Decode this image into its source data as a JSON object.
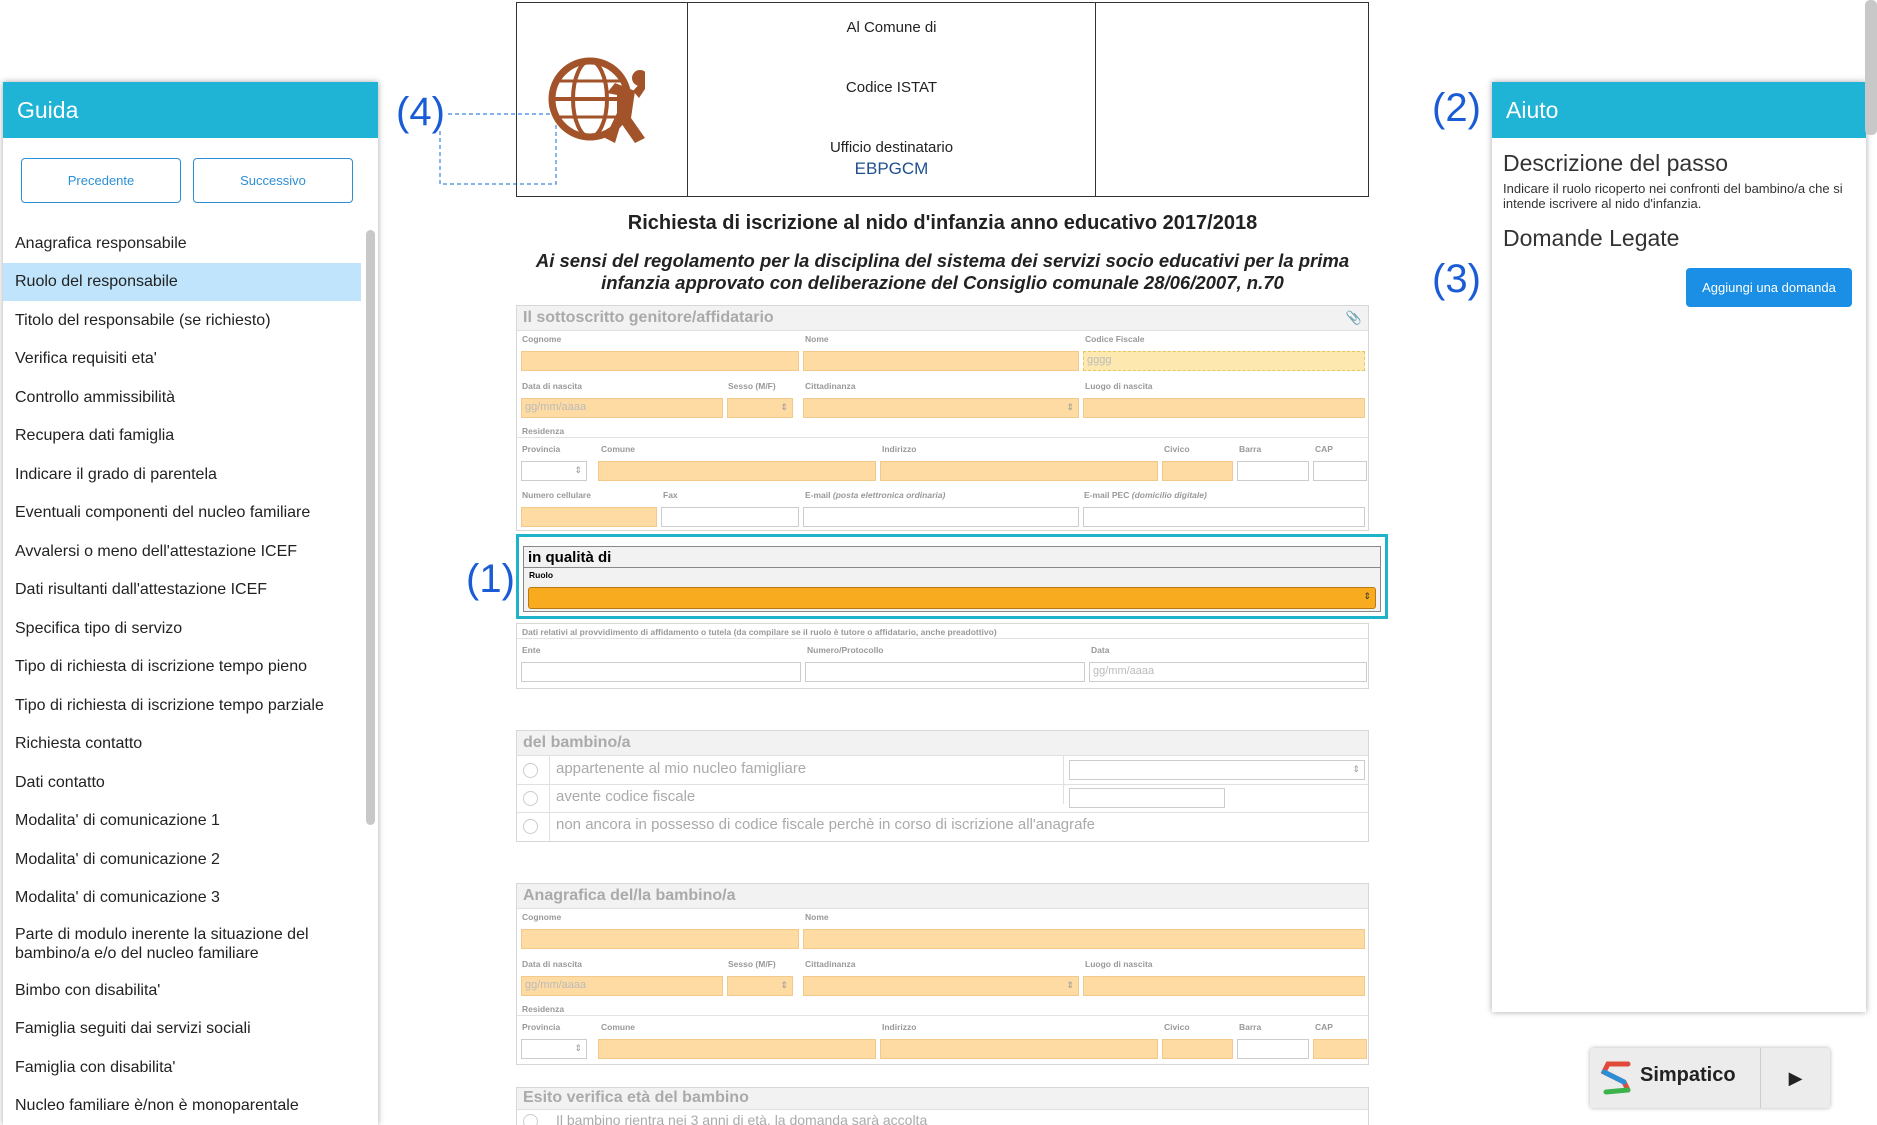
{
  "guida": {
    "title": "Guida",
    "prev_label": "Precedente",
    "next_label": "Successivo",
    "items": [
      {
        "label": "Anagrafica responsabile"
      },
      {
        "label": "Ruolo del responsabile"
      },
      {
        "label": "Titolo del responsabile (se richiesto)"
      },
      {
        "label": "Verifica requisiti eta'"
      },
      {
        "label": "Controllo ammissibilità"
      },
      {
        "label": "Recupera dati famiglia"
      },
      {
        "label": "Indicare il grado di parentela"
      },
      {
        "label": "Eventuali componenti del nucleo familiare"
      },
      {
        "label": "Avvalersi o meno dell'attestazione ICEF"
      },
      {
        "label": "Dati risultanti dall'attestazione ICEF"
      },
      {
        "label": "Specifica tipo di servizo"
      },
      {
        "label": "Tipo di richiesta di iscrizione tempo pieno"
      },
      {
        "label": "Tipo di richiesta di iscrizione tempo parziale"
      },
      {
        "label": "Richiesta contatto"
      },
      {
        "label": "Dati contatto"
      },
      {
        "label": "Modalita' di comunicazione 1"
      },
      {
        "label": "Modalita' di comunicazione 2"
      },
      {
        "label": "Modalita' di comunicazione 3"
      },
      {
        "label": "Parte di modulo inerente la situazione del bambino/a e/o del nucleo familiare"
      },
      {
        "label": "Bimbo con disabilita'"
      },
      {
        "label": "Famiglia seguiti dai servizi sociali"
      },
      {
        "label": "Famiglia con disabilita'"
      },
      {
        "label": "Nucleo familiare è/non è monoparentale"
      }
    ],
    "active_index": 1
  },
  "aiuto": {
    "title": "Aiuto",
    "desc_title": "Descrizione del passo",
    "desc_text": "Indicare il ruolo ricoperto nei confronti del bambino/a che si intende iscrivere al nido d'infanzia.",
    "linked_title": "Domande Legate",
    "add_label": "Aggiungi una domanda"
  },
  "markers": {
    "m1": "(1)",
    "m2": "(2)",
    "m3": "(3)",
    "m4": "(4)"
  },
  "header": {
    "comune": "Al Comune di",
    "istat": "Codice ISTAT",
    "ufficio": "Ufficio destinatario",
    "ufficio_code": "EBPGCM"
  },
  "form": {
    "title": "Richiesta di iscrizione al nido d'infanzia anno educativo 2017/2018",
    "subtitle": "Ai sensi del regolamento per la disciplina del sistema dei servizi socio educativi per la prima infanzia approvato con deliberazione del Consiglio comunale 28/06/2007, n.70",
    "sottoscritto": {
      "title": "Il sottoscritto genitore/affidatario",
      "cognome": "Cognome",
      "nome": "Nome",
      "cf": "Codice Fiscale",
      "cf_value": "gggg",
      "data_nascita": "Data di nascita",
      "sesso": "Sesso (M/F)",
      "cittadinanza": "Cittadinanza",
      "luogo_nascita": "Luogo di nascita",
      "date_ph": "gg/mm/aaaa",
      "residenza": "Residenza",
      "provincia": "Provincia",
      "comune": "Comune",
      "indirizzo": "Indirizzo",
      "civico": "Civico",
      "barra": "Barra",
      "cap": "CAP",
      "cellulare": "Numero cellulare",
      "fax": "Fax",
      "email": "E-mail",
      "email_hint": "(posta elettronica ordinaria)",
      "pec": "E-mail PEC",
      "pec_hint": "(domicilio digitale)"
    },
    "ruolo": {
      "title": "in qualità di",
      "label": "Ruolo"
    },
    "affido": {
      "title": "Dati relativi al provvidimento di affidamento o tutela (da compilare se il ruolo è tutore o affidatario, anche preadottivo)",
      "ente": "Ente",
      "numero": "Numero/Protocollo",
      "data": "Data",
      "date_ph": "gg/mm/aaaa"
    },
    "bambino": {
      "title": "del bambino/a",
      "opt1": "appartenente al mio nucleo famigliare",
      "opt2": "avente codice fiscale",
      "opt3": "non ancora in possesso di codice fiscale perchè in corso di iscrizione all'anagrafe"
    },
    "anagrafica": {
      "title": "Anagrafica del/la bambino/a",
      "cognome": "Cognome",
      "nome": "Nome",
      "data_nascita": "Data di nascita",
      "sesso": "Sesso (M/F)",
      "cittadinanza": "Cittadinanza",
      "luogo_nascita": "Luogo di nascita",
      "date_ph": "gg/mm/aaaa",
      "residenza": "Residenza",
      "provincia": "Provincia",
      "comune": "Comune",
      "indirizzo": "Indirizzo",
      "civico": "Civico",
      "barra": "Barra",
      "cap": "CAP"
    },
    "esito": {
      "title": "Esito verifica età del bambino",
      "opt1": "Il bambino rientra nei 3 anni di età, la domanda sarà accolta"
    }
  },
  "simpatico": {
    "label": "Simpatico"
  },
  "colors": {
    "accent": "#1fb3d5",
    "orange_field": "#fddba2",
    "ruolo_select": "#f8ab1e",
    "button_blue": "#1b8fe5",
    "marker_blue": "#1a5bd6"
  }
}
